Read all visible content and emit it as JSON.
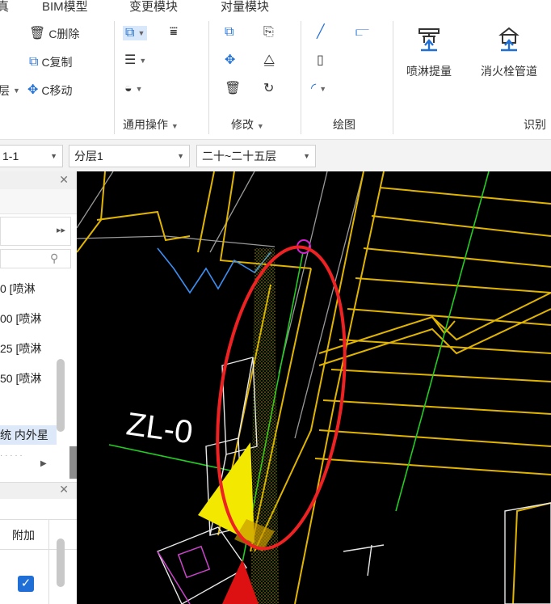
{
  "tabs": {
    "t0": "真",
    "t1": "BIM模型",
    "t2": "变更模块",
    "t3": "对量模块"
  },
  "ribbon": {
    "delete": "C删除",
    "copy": "C复制",
    "move": "C移动",
    "left_cut": "层",
    "sprinkler_extract": "喷淋提量",
    "hydrant_pipe": "消火栓管道",
    "groups": {
      "general_ops": "通用操作",
      "modify": "修改",
      "draw": "绘图",
      "identify": "识别"
    }
  },
  "selectors": {
    "floor_ref": "1-1",
    "layer": "分层1",
    "floor_range": "二十~二十五层"
  },
  "left_panel": {
    "items": [
      "0 [喷淋",
      "00 [喷淋",
      "25 [喷淋",
      "50 [喷淋"
    ],
    "highlight": "统 内外星",
    "cut_text": "  ·  ·  · · · ",
    "col_header": "附加"
  },
  "canvas": {
    "label": "ZL-0"
  },
  "colors": {
    "accent": "#1f6fd6",
    "annotation": "#ee2222",
    "wall": "#e0b400",
    "axis": "#22cc22"
  }
}
